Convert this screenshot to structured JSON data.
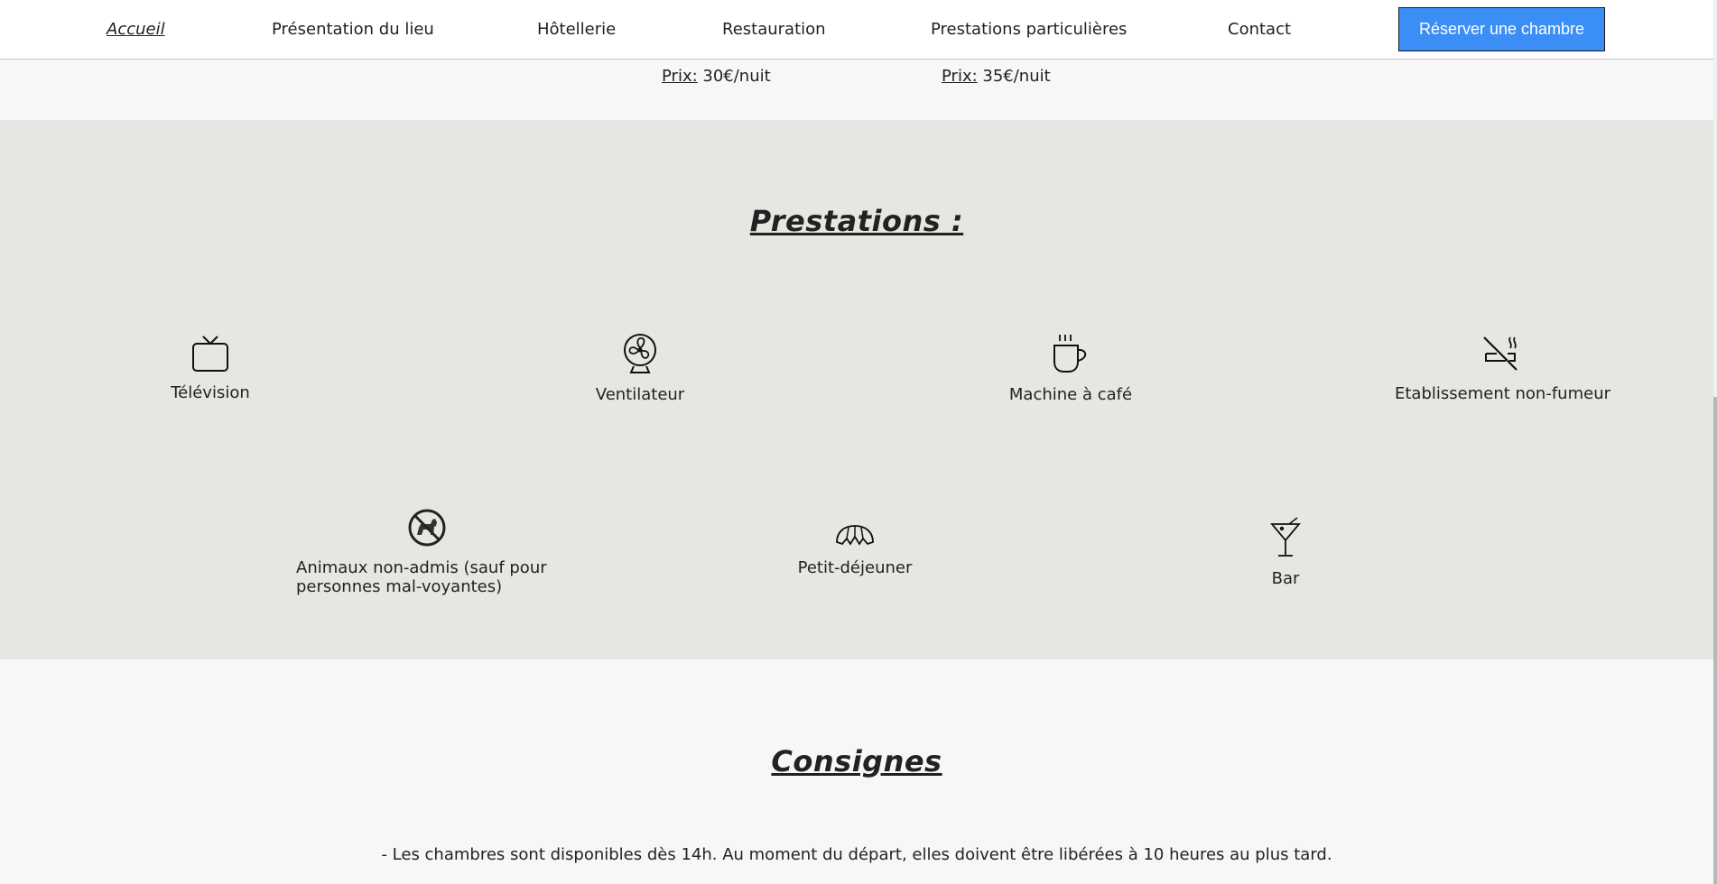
{
  "nav": {
    "items": [
      {
        "label": "Accueil"
      },
      {
        "label": "Présentation du lieu"
      },
      {
        "label": "Hôtellerie"
      },
      {
        "label": "Restauration"
      },
      {
        "label": "Prestations particulières"
      },
      {
        "label": "Contact"
      }
    ],
    "cta_label": "Réserver une chambre",
    "accent_color": "#3b8ef5"
  },
  "prices": [
    {
      "label": "Prix:",
      "value": "30€/nuit"
    },
    {
      "label": "Prix:",
      "value": "35€/nuit"
    }
  ],
  "services": {
    "title": "Prestations :",
    "items": [
      {
        "icon": "tv-icon",
        "label": "Télévision"
      },
      {
        "icon": "fan-icon",
        "label": "Ventilateur"
      },
      {
        "icon": "coffee-cup-icon",
        "label": "Machine à café"
      },
      {
        "icon": "no-smoking-icon",
        "label": "Etablissement non-fumeur"
      },
      {
        "icon": "no-pets-icon",
        "label": "Animaux non-admis (sauf pour personnes mal-voyantes)"
      },
      {
        "icon": "croissant-icon",
        "label": "Petit-déjeuner"
      },
      {
        "icon": "cocktail-icon",
        "label": "Bar"
      }
    ]
  },
  "rules": {
    "title": "Consignes",
    "text": "- Les chambres sont disponibles dès 14h. Au moment du départ, elles doivent être libérées à 10 heures au plus tard."
  }
}
